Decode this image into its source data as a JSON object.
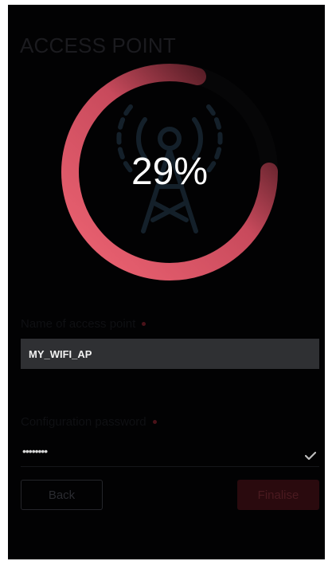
{
  "header": {
    "title": "ACCESS POINT"
  },
  "progress": {
    "value": 0.29,
    "label": "29%",
    "icon": "radio-tower-icon",
    "colors": {
      "start": "#ee6473",
      "end": "#3a0f18",
      "track": "#060607"
    }
  },
  "form": {
    "ap_name": {
      "label": "Name of access point",
      "value": "MY_WIFI_AP"
    },
    "password": {
      "label": "Configuration password",
      "value": "••••••••"
    }
  },
  "buttons": {
    "back": "Back",
    "finalise": "Finalise"
  },
  "colors": {
    "background": "#020203",
    "accent": "#e0505f"
  }
}
